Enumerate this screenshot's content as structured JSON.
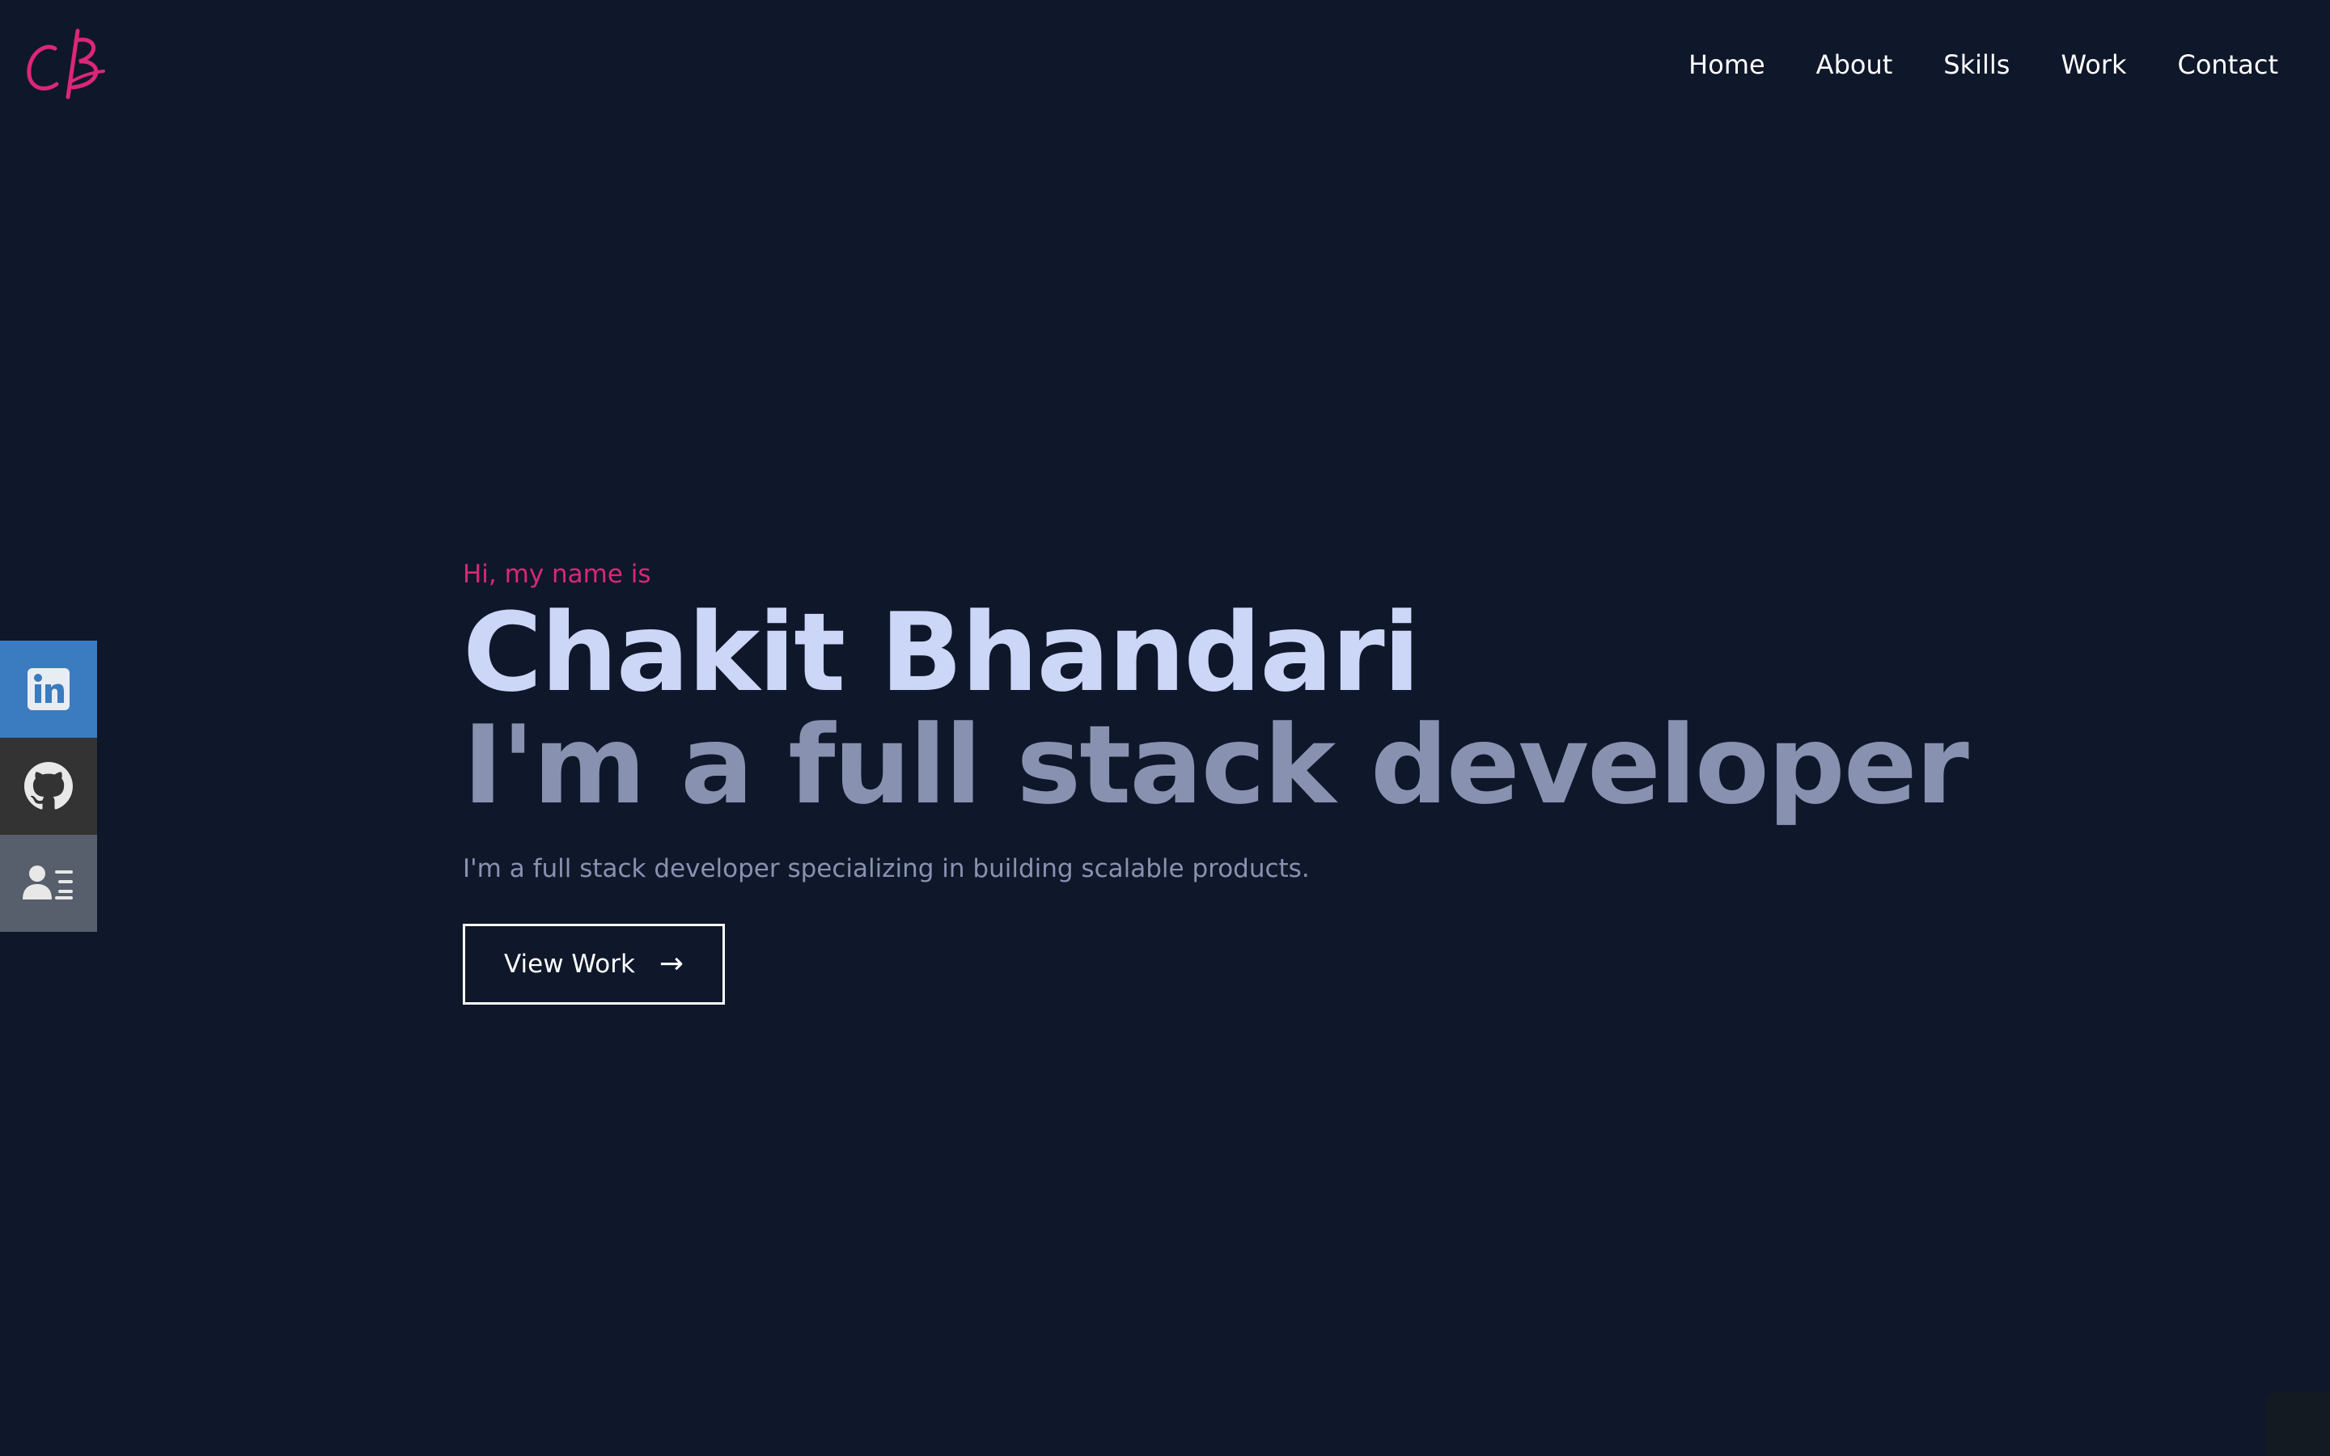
{
  "header": {
    "logo_alt": "CB",
    "nav": [
      {
        "label": "Home"
      },
      {
        "label": "About"
      },
      {
        "label": "Skills"
      },
      {
        "label": "Work"
      },
      {
        "label": "Contact"
      }
    ]
  },
  "social": {
    "items": [
      {
        "icon": "linkedin-icon",
        "color": "#3b7bbf"
      },
      {
        "icon": "github-icon",
        "color": "#333333"
      },
      {
        "icon": "resume-icon",
        "color": "#565f6b"
      }
    ]
  },
  "hero": {
    "greeting": "Hi, my name is",
    "name": "Chakit Bhandari",
    "tagline": "I'm a full stack developer",
    "description": "I'm a full stack developer specializing in building scalable products.",
    "cta_label": "View Work",
    "cta_arrow": "→"
  },
  "colors": {
    "background": "#0f172a",
    "accent": "#db2777",
    "name": "#ccd6f6",
    "muted": "#8892b0"
  }
}
